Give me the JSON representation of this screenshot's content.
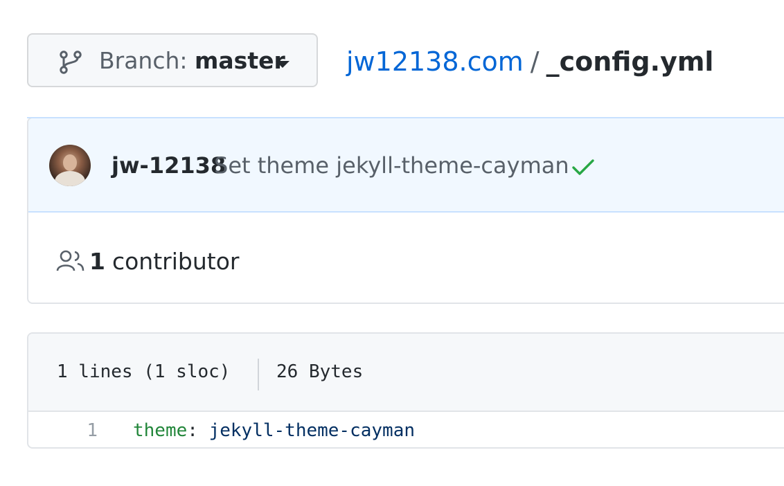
{
  "branch": {
    "prefix": "Branch:",
    "name": "master",
    "icon": "git-branch-icon"
  },
  "breadcrumb": {
    "repo": "jw12138.com",
    "separator": "/",
    "file": "_config.yml"
  },
  "commit": {
    "author": "jw-12138",
    "message": "Set theme jekyll-theme-cayman",
    "status_icon": "check-icon",
    "status_color": "#28a745"
  },
  "contributors": {
    "icon": "people-icon",
    "count": "1",
    "label": "contributor"
  },
  "file": {
    "lines_info": "1 lines (1 sloc)",
    "size": "26 Bytes",
    "code": [
      {
        "line_number": "1",
        "key": "theme",
        "separator": ": ",
        "value": "jekyll-theme-cayman"
      }
    ]
  },
  "colors": {
    "link": "#0366d6",
    "commit_bg": "#f1f8ff",
    "yaml_key": "#22863a",
    "yaml_value": "#032f62"
  }
}
